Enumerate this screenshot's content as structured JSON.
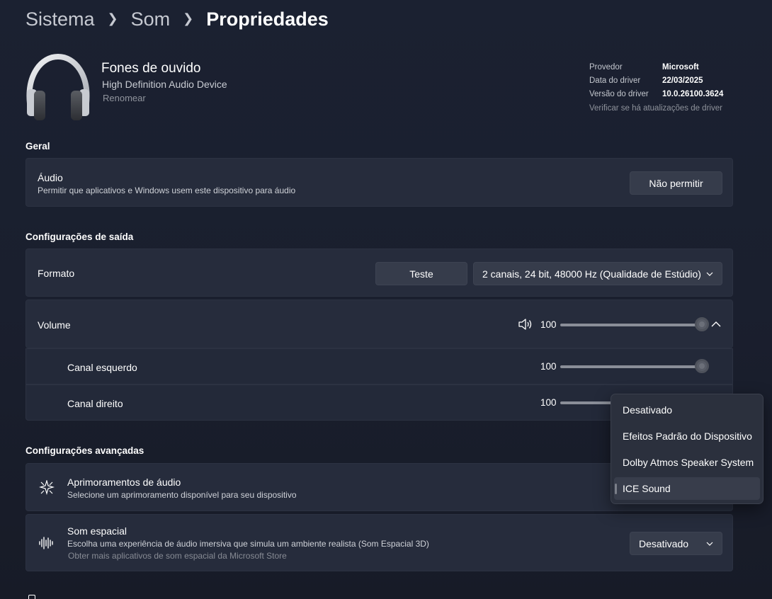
{
  "breadcrumb": {
    "level1": "Sistema",
    "level2": "Som",
    "current": "Propriedades"
  },
  "device": {
    "name": "Fones de ouvido",
    "subtitle": "High Definition Audio Device",
    "rename": "Renomear",
    "meta": {
      "provider_label": "Provedor",
      "provider_value": "Microsoft",
      "date_label": "Data do driver",
      "date_value": "22/03/2025",
      "version_label": "Versão do driver",
      "version_value": "10.0.26100.3624",
      "update_link": "Verificar se há atualizações de driver"
    }
  },
  "general": {
    "section_title": "Geral",
    "audio": {
      "title": "Áudio",
      "description": "Permitir que aplicativos e Windows usem este dispositivo para áudio",
      "button": "Não permitir"
    }
  },
  "output": {
    "section_title": "Configurações de saída",
    "format": {
      "label": "Formato",
      "test_button": "Teste",
      "selected": "2 canais, 24 bit, 48000 Hz (Qualidade de Estúdio)"
    },
    "volume": {
      "label": "Volume",
      "value": "100",
      "level": 1.0
    },
    "left_channel": {
      "label": "Canal esquerdo",
      "value": "100",
      "level": 1.0
    },
    "right_channel": {
      "label": "Canal direito",
      "value": "100",
      "level": 1.0
    }
  },
  "advanced": {
    "section_title": "Configurações avançadas",
    "enhancements": {
      "title": "Aprimoramentos de áudio",
      "description": "Selecione um aprimoramento disponível para seu dispositivo"
    },
    "spatial": {
      "title": "Som espacial",
      "description": "Escolha uma experiência de áudio imersiva que simula um ambiente realista (Som Espacial 3D)",
      "link": "Obter mais aplicativos de som espacial da Microsoft Store",
      "selected": "Desativado"
    }
  },
  "dropdown_menu": {
    "items": [
      "Desativado",
      "Efeitos Padrão do Dispositivo",
      "Dolby Atmos Speaker System",
      "ICE Sound"
    ],
    "selected_index": 3
  },
  "icons": {
    "headphones": "headphones-icon",
    "speaker": "speaker-volume-icon",
    "enhancements": "audio-enhancements-icon",
    "spatial": "spatial-sound-icon"
  }
}
